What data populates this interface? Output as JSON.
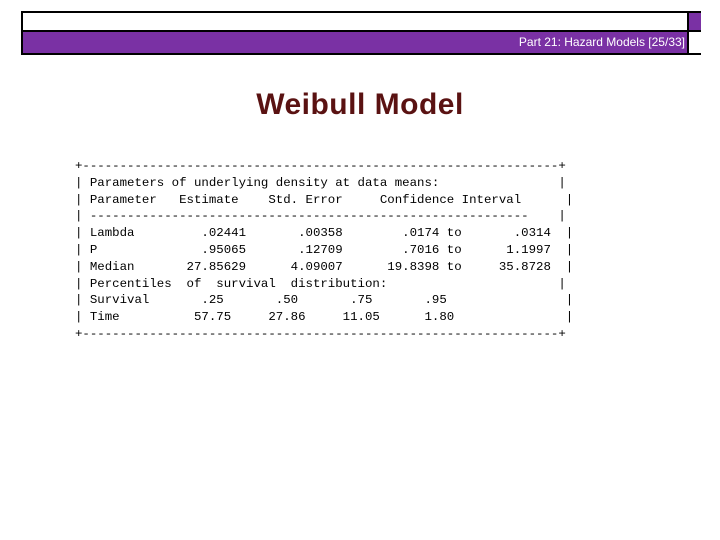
{
  "header": {
    "label": "Part 21: Hazard Models [25/33]"
  },
  "slide": {
    "title": "Weibull Model"
  },
  "output": {
    "lines": [
      "+----------------------------------------------------------------+",
      "| Parameters of underlying density at data means:                |",
      "| Parameter   Estimate    Std. Error     Confidence Interval      |",
      "| -----------------------------------------------------------    |",
      "| Lambda         .02441       .00358        .0174 to       .0314  |",
      "| P              .95065       .12709        .7016 to      1.1997  |",
      "| Median       27.85629      4.09007      19.8398 to     35.8728  |",
      "| Percentiles  of  survival  distribution:                       |",
      "| Survival       .25       .50       .75       .95                |",
      "| Time          57.75     27.86     11.05      1.80               |",
      "+----------------------------------------------------------------+"
    ]
  },
  "colors": {
    "header_band": "#7a31a4",
    "title": "#5a1212"
  }
}
